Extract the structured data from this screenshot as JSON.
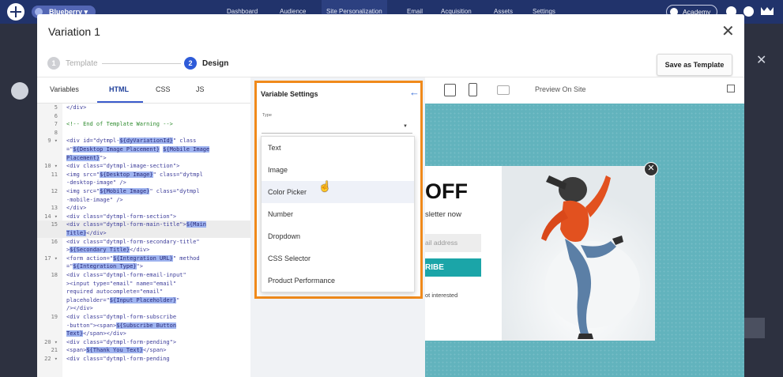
{
  "topbar": {
    "workspace": "Blueberry",
    "nav": [
      "Dashboard",
      "Audience",
      "Site Personalization",
      "Email",
      "Acquisition",
      "Assets",
      "Settings"
    ],
    "active_nav": "Site Personalization",
    "academy": "Academy",
    "colors": {
      "bar": "#21336b",
      "workspace_pill": "#5366b4"
    }
  },
  "modal": {
    "title": "Variation 1",
    "steps": [
      {
        "number": "1",
        "label": "Template",
        "state": "done"
      },
      {
        "number": "2",
        "label": "Design",
        "state": "current"
      }
    ],
    "save_as_template": "Save as Template"
  },
  "editor": {
    "tabs": [
      "Variables",
      "HTML",
      "CSS",
      "JS"
    ],
    "active_tab": "HTML",
    "lines": [
      {
        "n": "5",
        "fold": "",
        "parts": [
          {
            "t": "</div>"
          }
        ]
      },
      {
        "n": "6",
        "fold": "",
        "parts": [
          {
            "t": ""
          }
        ]
      },
      {
        "n": "7",
        "fold": "",
        "comment": true,
        "parts": [
          {
            "t": "<!--   End of Template Warning -->"
          }
        ]
      },
      {
        "n": "8",
        "fold": "",
        "parts": [
          {
            "t": ""
          }
        ]
      },
      {
        "n": "9",
        "fold": "▾",
        "parts": [
          {
            "t": "<div id=\"dytmpl-"
          },
          {
            "t": "${dyVariationId}",
            "s": true
          },
          {
            "t": "\" class"
          }
        ]
      },
      {
        "n": "",
        "fold": "",
        "parts": [
          {
            "t": "  =\""
          },
          {
            "t": "${Desktop Image Placement}",
            "s": true
          },
          {
            "t": " "
          },
          {
            "t": "${Mobile Image",
            "s": true
          }
        ]
      },
      {
        "n": "",
        "fold": "",
        "parts": [
          {
            "t": "  "
          },
          {
            "t": "Placement}",
            "s": true
          },
          {
            "t": "\">"
          }
        ]
      },
      {
        "n": "10",
        "fold": "▾",
        "parts": [
          {
            "t": "  <div class=\"dytmpl-image-section\">"
          }
        ]
      },
      {
        "n": "11",
        "fold": "",
        "parts": [
          {
            "t": "    <img src=\""
          },
          {
            "t": "${Desktop Image}",
            "s": true
          },
          {
            "t": "\" class=\"dytmpl"
          }
        ]
      },
      {
        "n": "",
        "fold": "",
        "parts": [
          {
            "t": "      -desktop-image\" />"
          }
        ]
      },
      {
        "n": "12",
        "fold": "",
        "parts": [
          {
            "t": "    <img src=\""
          },
          {
            "t": "${Mobile Image}",
            "s": true
          },
          {
            "t": "\" class=\"dytmpl"
          }
        ]
      },
      {
        "n": "",
        "fold": "",
        "parts": [
          {
            "t": "      -mobile-image\" />"
          }
        ]
      },
      {
        "n": "13",
        "fold": "",
        "parts": [
          {
            "t": "  </div>"
          }
        ]
      },
      {
        "n": "14",
        "fold": "▾",
        "parts": [
          {
            "t": "  <div class=\"dytmpl-form-section\">"
          }
        ]
      },
      {
        "n": "15",
        "fold": "",
        "hl": true,
        "parts": [
          {
            "t": "    <div class=\"dytmpl-form-main-title\">"
          },
          {
            "t": "${Main",
            "s": true
          }
        ]
      },
      {
        "n": "",
        "fold": "",
        "hl": true,
        "parts": [
          {
            "t": "      "
          },
          {
            "t": "Title}",
            "s": true
          },
          {
            "t": "</div>"
          }
        ]
      },
      {
        "n": "16",
        "fold": "",
        "parts": [
          {
            "t": "    <div class=\"dytmpl-form-secondary-title\""
          }
        ]
      },
      {
        "n": "",
        "fold": "",
        "parts": [
          {
            "t": "      >"
          },
          {
            "t": "${Secondary Title}",
            "s": true
          },
          {
            "t": "</div>"
          }
        ]
      },
      {
        "n": "17",
        "fold": "▾",
        "parts": [
          {
            "t": "    <form action=\""
          },
          {
            "t": "${Integration URL}",
            "s": true
          },
          {
            "t": "\" method"
          }
        ]
      },
      {
        "n": "",
        "fold": "",
        "parts": [
          {
            "t": "      =\""
          },
          {
            "t": "${Integration Type}",
            "s": true
          },
          {
            "t": "\">"
          }
        ]
      },
      {
        "n": "18",
        "fold": "",
        "parts": [
          {
            "t": "      <div class=\"dytmpl-form-email-input\""
          }
        ]
      },
      {
        "n": "",
        "fold": "",
        "parts": [
          {
            "t": "        ><input type=\"email\" name=\"email\""
          }
        ]
      },
      {
        "n": "",
        "fold": "",
        "parts": [
          {
            "t": "        required autocomplete=\"email\""
          }
        ]
      },
      {
        "n": "",
        "fold": "",
        "parts": [
          {
            "t": "        placeholder=\""
          },
          {
            "t": "${Input Placeholder}",
            "s": true
          },
          {
            "t": "\""
          }
        ]
      },
      {
        "n": "",
        "fold": "",
        "parts": [
          {
            "t": "        /></div>"
          }
        ]
      },
      {
        "n": "19",
        "fold": "",
        "parts": [
          {
            "t": "      <div class=\"dytmpl-form-subscribe"
          }
        ]
      },
      {
        "n": "",
        "fold": "",
        "parts": [
          {
            "t": "        -button\"><span>"
          },
          {
            "t": "${Subscribe Button",
            "s": true
          }
        ]
      },
      {
        "n": "",
        "fold": "",
        "parts": [
          {
            "t": "        "
          },
          {
            "t": "Text}",
            "s": true
          },
          {
            "t": "</span></div>"
          }
        ]
      },
      {
        "n": "20",
        "fold": "▾",
        "parts": [
          {
            "t": "      <div class=\"dytmpl-form-pending\">"
          }
        ]
      },
      {
        "n": "21",
        "fold": "",
        "parts": [
          {
            "t": "        <span>"
          },
          {
            "t": "${Thank You Text}",
            "s": true
          },
          {
            "t": "</span>"
          }
        ]
      },
      {
        "n": "22",
        "fold": "▾",
        "parts": [
          {
            "t": "        <div class=\"dytmpl-form-pending"
          }
        ]
      }
    ]
  },
  "variable_settings": {
    "title": "Variable Settings",
    "type_label": "Type",
    "options": [
      "Text",
      "Image",
      "Color Picker",
      "Number",
      "Dropdown",
      "CSS Selector",
      "Product Performance"
    ],
    "hovered": "Color Picker",
    "highlight_color": "#f08a1b"
  },
  "preview": {
    "preview_on_site": "Preview On Site",
    "headline": "OFF",
    "subline": "sletter now",
    "email_placeholder": "ail address",
    "cta": "RIBE",
    "not_interested": "ot interested",
    "canvas_color": "#62b3bd",
    "cta_color": "#1ba5a8"
  }
}
